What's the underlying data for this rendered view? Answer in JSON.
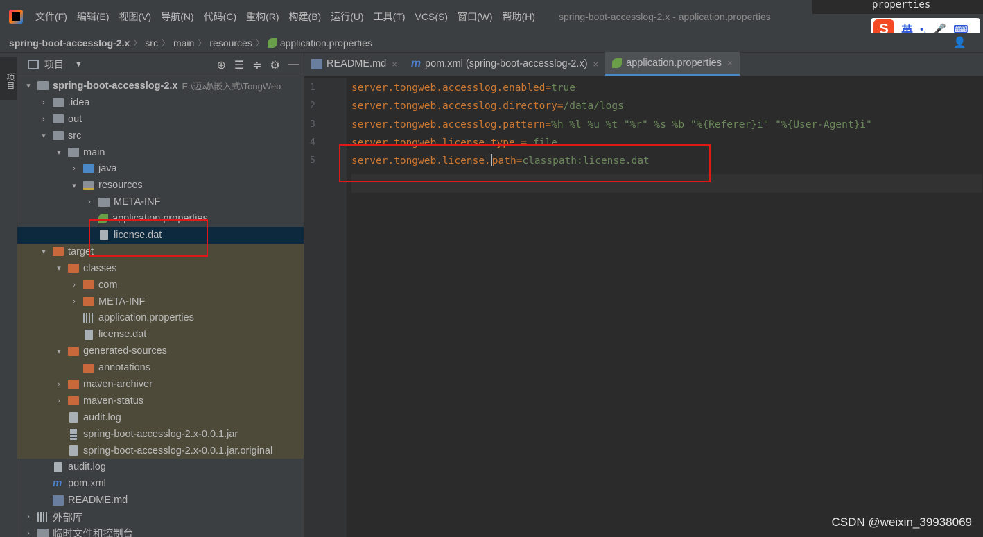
{
  "menubar": {
    "items": [
      "文件(F)",
      "编辑(E)",
      "视图(V)",
      "导航(N)",
      "代码(C)",
      "重构(R)",
      "构建(B)",
      "运行(U)",
      "工具(T)",
      "VCS(S)",
      "窗口(W)",
      "帮助(H)"
    ],
    "window_title": "spring-boot-accesslog-2.x - application.properties",
    "popup_text": "properties"
  },
  "ime": {
    "mode": "英",
    "punct": "•,",
    "logo": "S"
  },
  "breadcrumb": [
    "spring-boot-accesslog-2.x",
    "src",
    "main",
    "resources",
    "application.properties"
  ],
  "left_strip": {
    "tab_label": "项目"
  },
  "project_panel": {
    "title": "项目",
    "tree": [
      {
        "label": "spring-boot-accesslog-2.x",
        "path": "E:\\迈动\\嵌入式\\TongWeb",
        "indent": 0,
        "arrow": "down",
        "icon": "module"
      },
      {
        "label": ".idea",
        "indent": 1,
        "arrow": "right",
        "icon": "folder-grey"
      },
      {
        "label": "out",
        "indent": 1,
        "arrow": "right",
        "icon": "folder-grey"
      },
      {
        "label": "src",
        "indent": 1,
        "arrow": "down",
        "icon": "folder-grey"
      },
      {
        "label": "main",
        "indent": 2,
        "arrow": "down",
        "icon": "folder-grey"
      },
      {
        "label": "java",
        "indent": 3,
        "arrow": "right",
        "icon": "folder-blue"
      },
      {
        "label": "resources",
        "indent": 3,
        "arrow": "down",
        "icon": "folder-res"
      },
      {
        "label": "META-INF",
        "indent": 4,
        "arrow": "right",
        "icon": "folder-grey"
      },
      {
        "label": "application.properties",
        "indent": 4,
        "arrow": "none",
        "icon": "props"
      },
      {
        "label": "license.dat",
        "indent": 4,
        "arrow": "none",
        "icon": "file",
        "selected": true
      },
      {
        "label": "target",
        "indent": 1,
        "arrow": "down",
        "icon": "folder-orange",
        "target": true
      },
      {
        "label": "classes",
        "indent": 2,
        "arrow": "down",
        "icon": "folder-orange",
        "target": true
      },
      {
        "label": "com",
        "indent": 3,
        "arrow": "right",
        "icon": "folder-orange",
        "target": true
      },
      {
        "label": "META-INF",
        "indent": 3,
        "arrow": "right",
        "icon": "folder-orange",
        "target": true
      },
      {
        "label": "application.properties",
        "indent": 3,
        "arrow": "none",
        "icon": "lib",
        "target": true
      },
      {
        "label": "license.dat",
        "indent": 3,
        "arrow": "none",
        "icon": "file",
        "target": true
      },
      {
        "label": "generated-sources",
        "indent": 2,
        "arrow": "down",
        "icon": "folder-orange",
        "target": true
      },
      {
        "label": "annotations",
        "indent": 3,
        "arrow": "none",
        "icon": "folder-orange",
        "target": true
      },
      {
        "label": "maven-archiver",
        "indent": 2,
        "arrow": "right",
        "icon": "folder-orange",
        "target": true
      },
      {
        "label": "maven-status",
        "indent": 2,
        "arrow": "right",
        "icon": "folder-orange",
        "target": true
      },
      {
        "label": "audit.log",
        "indent": 2,
        "arrow": "none",
        "icon": "file",
        "target": true
      },
      {
        "label": "spring-boot-accesslog-2.x-0.0.1.jar",
        "indent": 2,
        "arrow": "none",
        "icon": "jar",
        "target": true
      },
      {
        "label": "spring-boot-accesslog-2.x-0.0.1.jar.original",
        "indent": 2,
        "arrow": "none",
        "icon": "file",
        "target": true
      },
      {
        "label": "audit.log",
        "indent": 1,
        "arrow": "none",
        "icon": "file"
      },
      {
        "label": "pom.xml",
        "indent": 1,
        "arrow": "none",
        "icon": "maven"
      },
      {
        "label": "README.md",
        "indent": 1,
        "arrow": "none",
        "icon": "md"
      },
      {
        "label": "外部库",
        "indent": 0,
        "arrow": "right",
        "icon": "lib"
      },
      {
        "label": "临时文件和控制台",
        "indent": 0,
        "arrow": "right",
        "icon": "folder-grey"
      }
    ]
  },
  "editor": {
    "tabs": [
      {
        "label": "README.md",
        "icon": "md",
        "active": false
      },
      {
        "label": "pom.xml (spring-boot-accesslog-2.x)",
        "icon": "maven",
        "active": false
      },
      {
        "label": "application.properties",
        "icon": "props",
        "active": true
      }
    ],
    "lines": [
      {
        "num": "1",
        "key": "server.tongweb.accesslog.enabled",
        "sep": "=",
        "value": "true"
      },
      {
        "num": "2",
        "key": "server.tongweb.accesslog.directory",
        "sep": "=",
        "value": "/data/logs"
      },
      {
        "num": "3",
        "key": "server.tongweb.accesslog.pattern",
        "sep": "=",
        "value": "%h %l %u %t \"%r\" %s %b \"%{Referer}i\" \"%{User-Agent}i\""
      },
      {
        "num": "4",
        "key": "server.tongweb.license.type",
        "sep": " = ",
        "value": "file"
      },
      {
        "num": "5",
        "key_a": "server.tongweb.license.",
        "key_b": "path",
        "sep": "=",
        "value": "classpath:license.dat"
      }
    ]
  },
  "watermark": "CSDN @weixin_39938069",
  "colors": {
    "key": "#cc7832",
    "value": "#6a8759",
    "highlight_box": "#e01818"
  }
}
